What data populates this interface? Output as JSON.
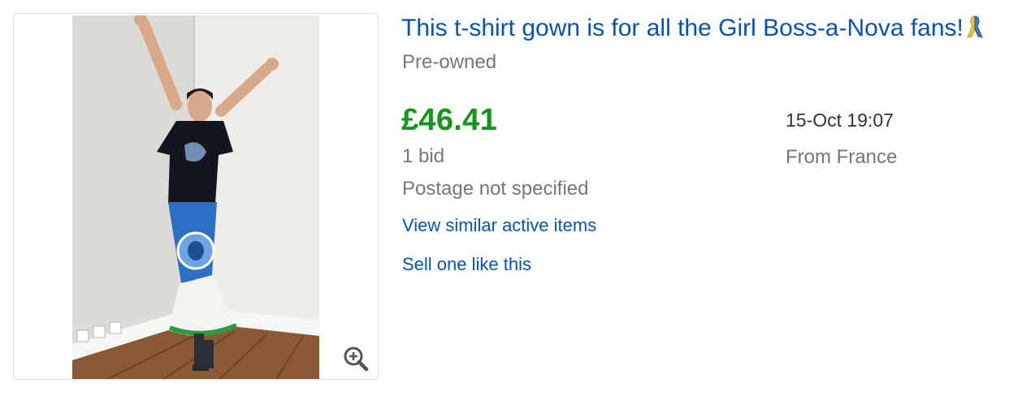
{
  "listing": {
    "title": "This t-shirt gown is for all the Girl Boss-a-Nova fans!",
    "title_icon": "awareness-ribbon-icon",
    "condition": "Pre-owned",
    "price": "£46.41",
    "bids": "1 bid",
    "postage": "Postage not specified",
    "end_time": "15-Oct 19:07",
    "location": "From France",
    "links": {
      "similar": "View similar active items",
      "sell": "Sell one like this"
    },
    "image": {
      "zoom_icon": "magnifier-plus-icon"
    }
  },
  "colors": {
    "link": "#0654ba",
    "price": "#119916",
    "muted": "#767676",
    "text": "#333333",
    "border": "#dddddd"
  }
}
